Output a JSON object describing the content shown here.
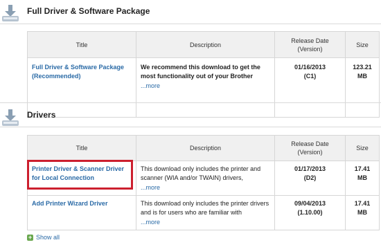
{
  "sections": {
    "package": {
      "title": "Full Driver & Software Package",
      "headers": {
        "title": "Title",
        "description": "Description",
        "release_date": "Release Date\n(Version)",
        "size": "Size"
      },
      "rows": [
        {
          "title": "Full Driver & Software Package (Recommended)",
          "description": "We recommend this download to get the most functionality out of your Brother",
          "more": "...more",
          "date": "01/16/2013",
          "version": "(C1)",
          "size": "123.21 MB"
        }
      ]
    },
    "drivers": {
      "title": "Drivers",
      "headers": {
        "title": "Title",
        "description": "Description",
        "release_date": "Release Date\n(Version)",
        "size": "Size"
      },
      "rows": [
        {
          "title": "Printer Driver & Scanner Driver for Local Connection",
          "description": "This download only includes the printer and scanner (WIA and/or TWAIN) drivers,",
          "more": "...more",
          "date": "01/17/2013",
          "version": "(D2)",
          "size": "17.41 MB"
        },
        {
          "title": "Add Printer Wizard Driver",
          "description": "This download only includes the printer drivers and is for users who are familiar with",
          "more": "...more",
          "date": "09/04/2013",
          "version": "(1.10.00)",
          "size": "17.41 MB"
        }
      ]
    }
  },
  "show_all_label": "Show all",
  "icons": {
    "section": "download-tray-icon",
    "show_all": "plus-icon"
  },
  "colors": {
    "link": "#2a6aa6",
    "highlight": "#cc1f2e",
    "header_bg": "#f0f0f0"
  }
}
